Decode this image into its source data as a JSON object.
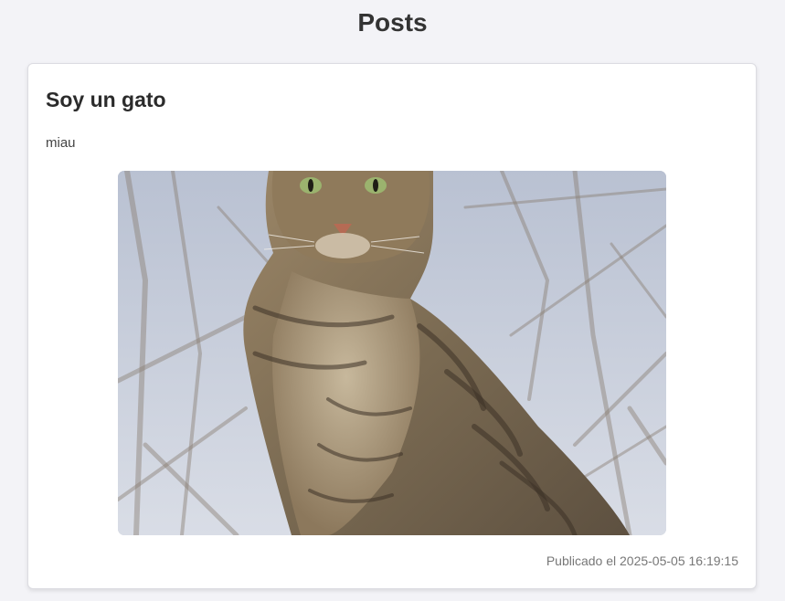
{
  "page": {
    "title": "Posts"
  },
  "post": {
    "title": "Soy un gato",
    "body": "miau",
    "image_subject": "tabby cat sitting in front of bare branches",
    "published": "Publicado el 2025-05-05 16:19:15"
  },
  "colors": {
    "background": "#f3f3f7",
    "card": "#ffffff",
    "text": "#2b2b2b",
    "muted": "#777777"
  }
}
